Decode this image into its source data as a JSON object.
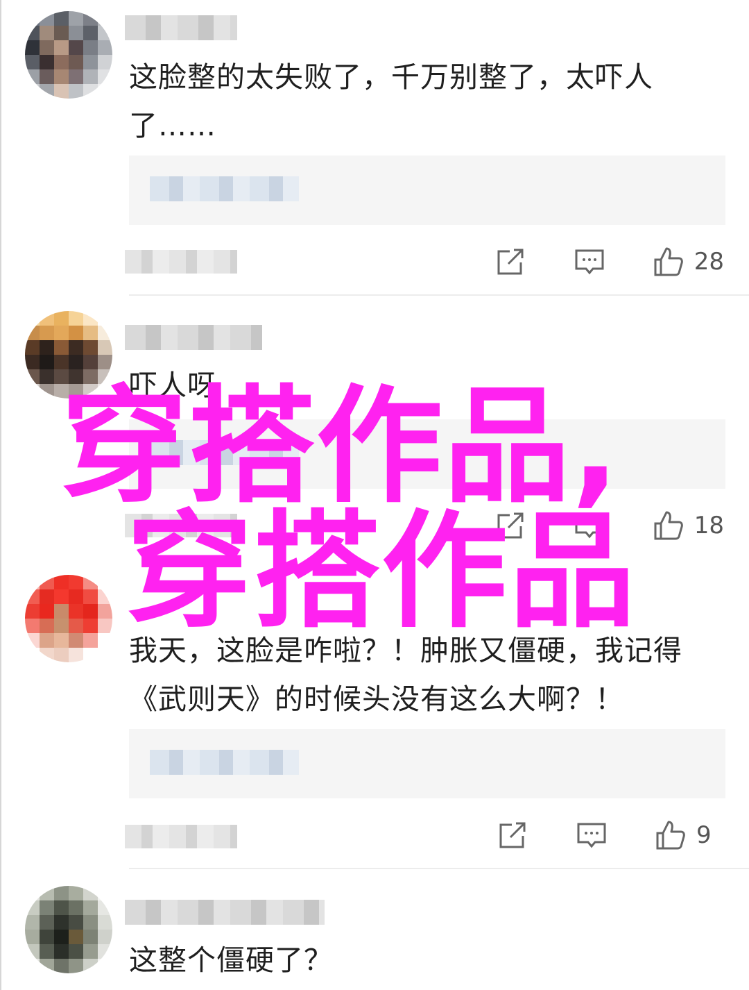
{
  "comments": [
    {
      "text": "这脸整的太失败了，千万别整了，太吓人了……",
      "likes": "28"
    },
    {
      "text": "吓人呀",
      "likes": "18"
    },
    {
      "text": "我天，这脸是咋啦？！肿胀又僵硬，我记得《武则天》的时候头没有这么大啊？！",
      "likes": "9"
    },
    {
      "text": "这整个僵硬了？"
    }
  ],
  "overlay": {
    "line1": "穿搭作品,",
    "line2": "穿搭作品"
  },
  "icons": {
    "share": "share-icon",
    "reply": "comment-icon",
    "like": "thumbs-up-icon"
  },
  "colors": {
    "overlay": "#ff22f0",
    "quote_bg": "#f5f5f5",
    "divider": "#ececec"
  }
}
